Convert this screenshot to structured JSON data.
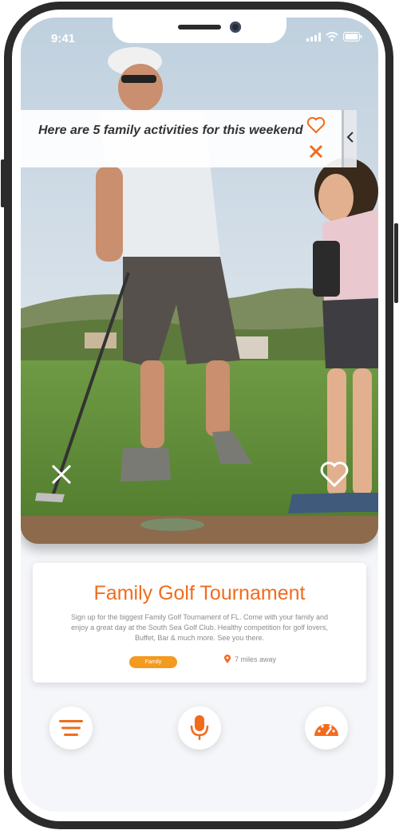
{
  "status": {
    "time": "9:41"
  },
  "banner": {
    "text": "Here are 5 family activities for this weekend"
  },
  "event": {
    "title": "Family Golf Tournament",
    "description": "Sign up for the biggest Family Golf Tournament of FL. Come with your family and enjoy a great day at the South Sea Golf Club. Healthy competition for golf lovers, Buffet, Bar & much more.  See you there.",
    "tag": "Family",
    "distance": "7 miles away"
  },
  "icons": {
    "banner_like": "heart-icon",
    "banner_dismiss": "close-icon",
    "photo_dismiss": "close-icon",
    "photo_like": "heart-icon",
    "nav_menu": "menu-icon",
    "nav_voice": "microphone-icon",
    "nav_dashboard": "speedometer-icon",
    "location": "location-pin-icon"
  },
  "colors": {
    "accent": "#f26b1d",
    "tag": "#f39a1f"
  }
}
